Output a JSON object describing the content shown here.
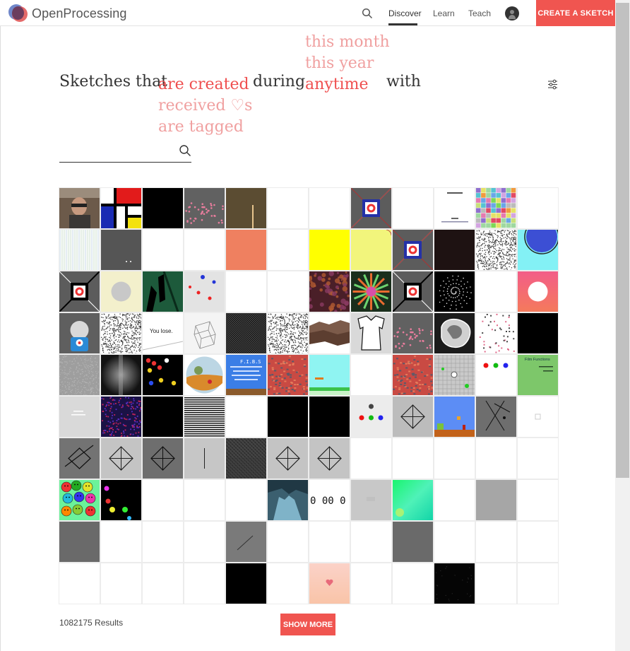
{
  "header": {
    "brand": "OpenProcessing",
    "nav": {
      "discover": "Discover",
      "learn": "Learn",
      "teach": "Teach"
    },
    "create_label": "CREATE A SKETCH",
    "accent": "#f05550"
  },
  "filter": {
    "prefix": "Sketches that",
    "verbs": [
      "are created",
      "received ♡s",
      "are tagged"
    ],
    "selected_verb": "are created",
    "during": "during",
    "times": [
      "this month",
      "this year",
      "anytime"
    ],
    "selected_time": "anytime",
    "with": "with",
    "search_placeholder": "",
    "selected_color": "#ef4f4f",
    "option_color": "#f0a0a0"
  },
  "sketches": [
    "photo",
    "mondrian",
    "black",
    "gray-pink-dots",
    "olive-line",
    "blank",
    "blank",
    "target-x",
    "blank",
    "text-page",
    "color-grid",
    "blank",
    "pale-lines",
    "gray-dots",
    "blank",
    "blank",
    "salmon",
    "blank",
    "yellow",
    "yellow-arc",
    "target-x",
    "dark-brown",
    "noise",
    "cyan-circle",
    "target-diag",
    "yellow-circle",
    "green-figure",
    "scatter",
    "blank",
    "blank",
    "psy-purple",
    "psy-green",
    "target-diag",
    "spiral-particles",
    "blank",
    "pink-circle",
    "robot",
    "noise",
    "you-lose",
    "cube",
    "crosshatch",
    "noise",
    "terrain",
    "shirt",
    "gray-pink-dots",
    "metal-blob",
    "pink-scatter",
    "black",
    "gray-noise",
    "gray-glow",
    "pacman",
    "painting",
    "fibs",
    "red-pattern",
    "cyan-platform",
    "blank",
    "red-pattern",
    "gray-grid",
    "rgb-dots",
    "film-functions",
    "lightgray-bar",
    "purple-noise",
    "black",
    "stripes",
    "blank",
    "black",
    "black",
    "rgb-triangle",
    "diamond-gray",
    "mario",
    "gray-lines",
    "small-square",
    "gray-diamond-x",
    "gray-diamond",
    "dark-diamond",
    "gray-line",
    "dark-fuzzy",
    "gray-diamond",
    "gray-diamond",
    "blank",
    "blank",
    "blank",
    "blank",
    "blank",
    "smileys",
    "color-balls",
    "blank",
    "blank",
    "blank",
    "hand-photo",
    "clock",
    "gray-smudge",
    "green-gradient",
    "blank",
    "gray-solid",
    "blank",
    "dark-gray",
    "blank",
    "blank",
    "blank",
    "diag-gray",
    "blank",
    "blank",
    "blank",
    "dark-gray",
    "blank",
    "blank",
    "blank",
    "blank",
    "blank",
    "blank",
    "blank",
    "black",
    "blank",
    "pink-heart",
    "blank",
    "blank",
    "black-scatter",
    "blank",
    "blank"
  ],
  "tile_text": {
    "you_lose": "You lose.",
    "fibs": "F.I.B.S",
    "film_functions": "Film Functions",
    "clock": "0 00 0"
  },
  "footer": {
    "results": "1082175 Results",
    "show_more": "SHOW MORE"
  }
}
